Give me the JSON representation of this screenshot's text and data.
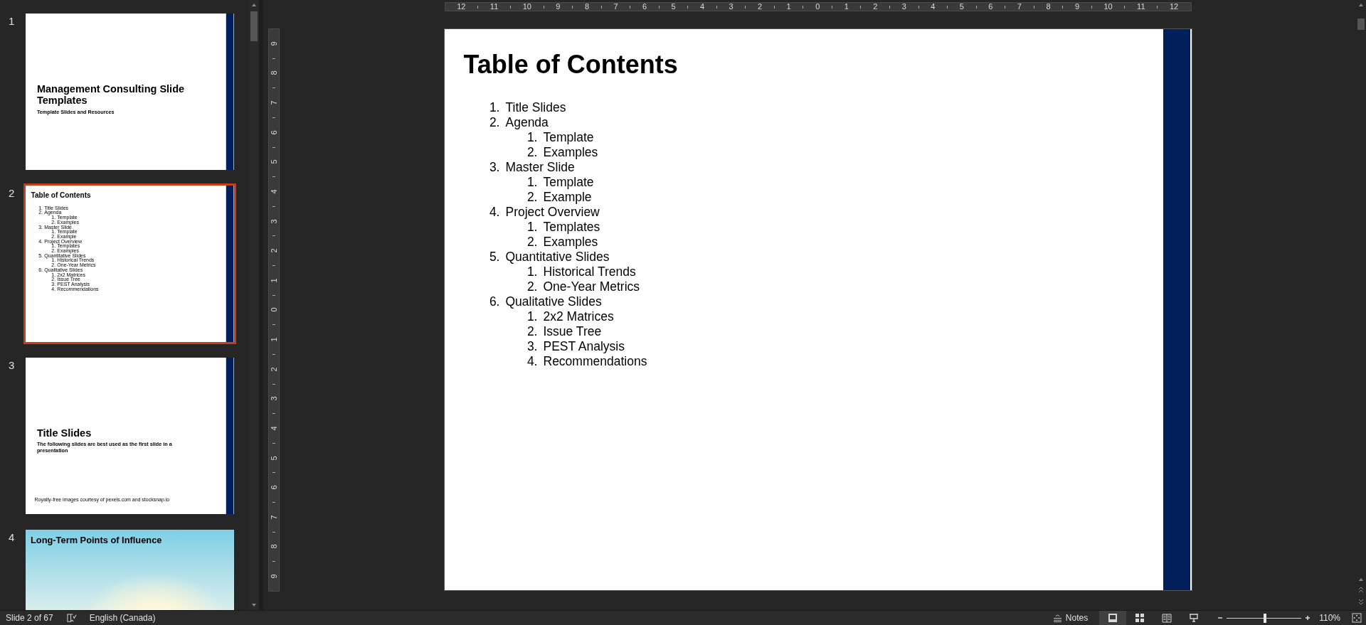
{
  "thumbnails": [
    {
      "number": "1",
      "selected": false,
      "kind": "title",
      "title": "Management Consulting Slide Templates",
      "subtitle": "Template Slides and Resources"
    },
    {
      "number": "2",
      "selected": true,
      "kind": "toc",
      "title": "Table of Contents",
      "items": [
        {
          "number": "1.",
          "text": "Title Slides"
        },
        {
          "number": "2.",
          "text": "Agenda",
          "children": [
            {
              "number": "1.",
              "text": "Template"
            },
            {
              "number": "2.",
              "text": "Examples"
            }
          ]
        },
        {
          "number": "3.",
          "text": "Master Slide",
          "children": [
            {
              "number": "1.",
              "text": "Template"
            },
            {
              "number": "2.",
              "text": "Example"
            }
          ]
        },
        {
          "number": "4.",
          "text": "Project Overview",
          "children": [
            {
              "number": "1.",
              "text": "Templates"
            },
            {
              "number": "2.",
              "text": "Examples"
            }
          ]
        },
        {
          "number": "5.",
          "text": "Quantitative Slides",
          "children": [
            {
              "number": "1.",
              "text": "Historical Trends"
            },
            {
              "number": "2.",
              "text": "One-Year Metrics"
            }
          ]
        },
        {
          "number": "6.",
          "text": "Qualitative Slides",
          "children": [
            {
              "number": "1.",
              "text": "2x2 Matrices"
            },
            {
              "number": "2.",
              "text": "Issue Tree"
            },
            {
              "number": "3.",
              "text": "PEST Analysis"
            },
            {
              "number": "4.",
              "text": "Recommendations"
            }
          ]
        }
      ]
    },
    {
      "number": "3",
      "selected": false,
      "kind": "title",
      "title": "Title Slides",
      "subtitle": "The following slides are best used as the first slide in a presentation",
      "footer": "Royalty-free images courtesy of pexels.com and stocksnap.io"
    },
    {
      "number": "4",
      "selected": false,
      "kind": "picture",
      "title": "Long-Term Points of Influence"
    }
  ],
  "horizontal_ruler": {
    "labels": [
      "12",
      "11",
      "10",
      "9",
      "8",
      "7",
      "6",
      "5",
      "4",
      "3",
      "2",
      "1",
      "0",
      "1",
      "2",
      "3",
      "4",
      "5",
      "6",
      "7",
      "8",
      "9",
      "10",
      "11",
      "12"
    ]
  },
  "vertical_ruler": {
    "labels": [
      "9",
      "8",
      "7",
      "6",
      "5",
      "4",
      "3",
      "2",
      "1",
      "0",
      "1",
      "2",
      "3",
      "4",
      "5",
      "6",
      "7",
      "8",
      "9"
    ]
  },
  "slide": {
    "kind": "toc",
    "title": "Table of Contents",
    "items": [
      {
        "number": "1.",
        "text": "Title Slides"
      },
      {
        "number": "2.",
        "text": "Agenda",
        "children": [
          {
            "number": "1.",
            "text": "Template"
          },
          {
            "number": "2.",
            "text": "Examples"
          }
        ]
      },
      {
        "number": "3.",
        "text": "Master Slide",
        "children": [
          {
            "number": "1.",
            "text": "Template"
          },
          {
            "number": "2.",
            "text": "Example"
          }
        ]
      },
      {
        "number": "4.",
        "text": "Project Overview",
        "children": [
          {
            "number": "1.",
            "text": "Templates"
          },
          {
            "number": "2.",
            "text": "Examples"
          }
        ]
      },
      {
        "number": "5.",
        "text": "Quantitative Slides",
        "children": [
          {
            "number": "1.",
            "text": "Historical Trends"
          },
          {
            "number": "2.",
            "text": "One-Year Metrics"
          }
        ]
      },
      {
        "number": "6.",
        "text": "Qualitative Slides",
        "children": [
          {
            "number": "1.",
            "text": "2x2 Matrices"
          },
          {
            "number": "2.",
            "text": "Issue Tree"
          },
          {
            "number": "3.",
            "text": "PEST Analysis"
          },
          {
            "number": "4.",
            "text": "Recommendations"
          }
        ]
      }
    ]
  },
  "status_bar": {
    "slide_indicator": "Slide 2 of 67",
    "language": "English (Canada)",
    "notes": "Notes",
    "views": [
      {
        "kind": "normal",
        "selected": true
      },
      {
        "kind": "sorter",
        "selected": false
      },
      {
        "kind": "reading",
        "selected": false
      },
      {
        "kind": "slideshow",
        "selected": false
      }
    ],
    "zoom": {
      "level": 0.51,
      "reading": "110%"
    }
  }
}
